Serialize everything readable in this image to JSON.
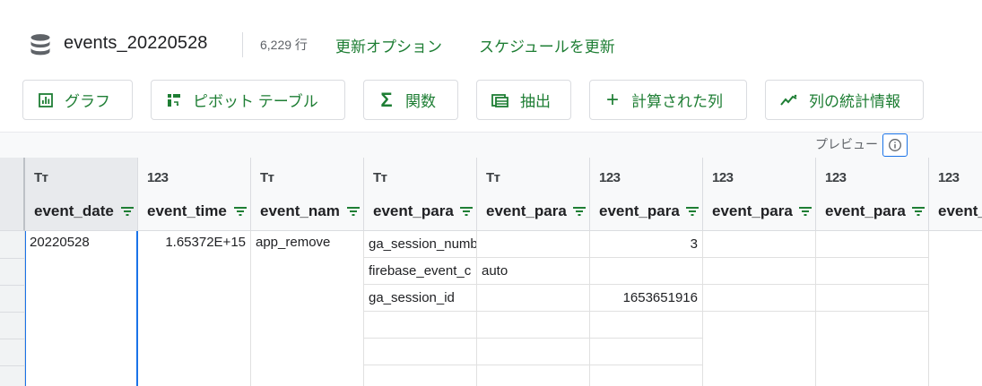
{
  "header": {
    "table_name": "events_20220528",
    "row_count": "6,229 行",
    "refresh_options": "更新オプション",
    "schedule_refresh": "スケジュールを更新"
  },
  "toolbar": {
    "chart": "グラフ",
    "pivot": "ピボット テーブル",
    "function": "関数",
    "extract": "抽出",
    "calculated_column": "計算された列",
    "column_stats": "列の統計情報"
  },
  "preview": {
    "label": "プレビュー"
  },
  "columns": [
    {
      "type": "Tт",
      "name": "event_date"
    },
    {
      "type": "123",
      "name": "event_time"
    },
    {
      "type": "Tт",
      "name": "event_nam"
    },
    {
      "type": "Tт",
      "name": "event_para"
    },
    {
      "type": "Tт",
      "name": "event_para"
    },
    {
      "type": "123",
      "name": "event_para"
    },
    {
      "type": "123",
      "name": "event_para"
    },
    {
      "type": "123",
      "name": "event_para"
    },
    {
      "type": "123",
      "name": "event_"
    }
  ],
  "row": {
    "event_date": "20220528",
    "event_time": "1.65372E+15",
    "event_name": "app_remove",
    "params": [
      {
        "key": "ga_session_number",
        "string_value": "",
        "int_value": "3"
      },
      {
        "key": "firebase_event_c",
        "string_value": "auto",
        "int_value": ""
      },
      {
        "key": "ga_session_id",
        "string_value": "",
        "int_value": "1653651916"
      }
    ]
  },
  "colors": {
    "accent_green": "#1e7e34",
    "selection_blue": "#1a73e8"
  }
}
